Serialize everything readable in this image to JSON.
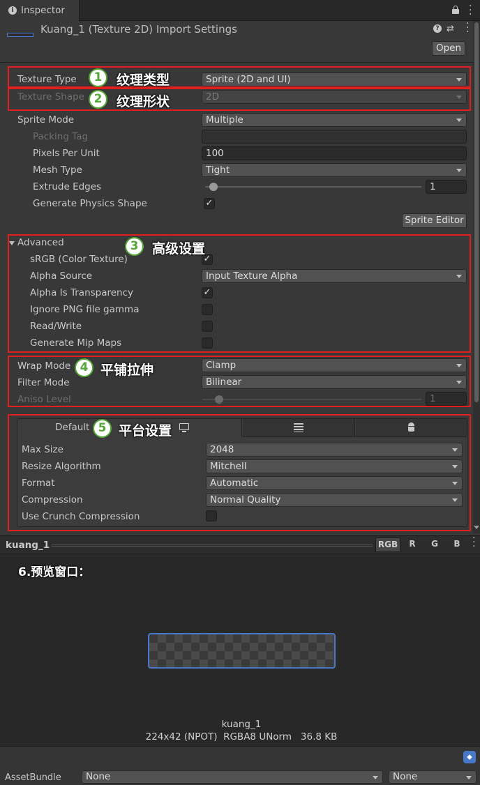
{
  "tab": {
    "title": "Inspector",
    "icon": "info-icon"
  },
  "header": {
    "title": "Kuang_1 (Texture 2D) Import Settings",
    "open_button": "Open"
  },
  "rows": {
    "texture_type": {
      "label": "Texture Type",
      "value": "Sprite (2D and UI)"
    },
    "texture_shape": {
      "label": "Texture Shape",
      "value": "2D"
    },
    "sprite_mode": {
      "label": "Sprite Mode",
      "value": "Multiple"
    },
    "packing_tag": {
      "label": "Packing Tag",
      "value": ""
    },
    "pixels_per_unit": {
      "label": "Pixels Per Unit",
      "value": "100"
    },
    "mesh_type": {
      "label": "Mesh Type",
      "value": "Tight"
    },
    "extrude_edges": {
      "label": "Extrude Edges",
      "value": "1"
    },
    "generate_physics_shape": {
      "label": "Generate Physics Shape",
      "checked": true
    },
    "sprite_editor_button": "Sprite Editor",
    "advanced": "Advanced",
    "srgb": {
      "label": "sRGB (Color Texture)",
      "checked": true
    },
    "alpha_source": {
      "label": "Alpha Source",
      "value": "Input Texture Alpha"
    },
    "alpha_is_transparency": {
      "label": "Alpha Is Transparency",
      "checked": true
    },
    "ignore_png_gamma": {
      "label": "Ignore PNG file gamma",
      "checked": false
    },
    "read_write": {
      "label": "Read/Write",
      "checked": false
    },
    "generate_mip_maps": {
      "label": "Generate Mip Maps",
      "checked": false
    },
    "wrap_mode": {
      "label": "Wrap Mode",
      "value": "Clamp"
    },
    "filter_mode": {
      "label": "Filter Mode",
      "value": "Bilinear"
    },
    "aniso_level": {
      "label": "Aniso Level",
      "value": "1"
    }
  },
  "platform": {
    "tabs": [
      "Default",
      "standalone-icon",
      "android-icon"
    ],
    "max_size": {
      "label": "Max Size",
      "value": "2048"
    },
    "resize_algorithm": {
      "label": "Resize Algorithm",
      "value": "Mitchell"
    },
    "format": {
      "label": "Format",
      "value": "Automatic"
    },
    "compression": {
      "label": "Compression",
      "value": "Normal Quality"
    },
    "use_crunch": {
      "label": "Use Crunch Compression",
      "checked": false
    }
  },
  "annotations": {
    "a1": {
      "num": "1",
      "text": "纹理类型"
    },
    "a2": {
      "num": "2",
      "text": "纹理形状"
    },
    "a3": {
      "num": "3",
      "text": "高级设置"
    },
    "a4": {
      "num": "4",
      "text": "平铺拉伸"
    },
    "a5": {
      "num": "5",
      "text": "平台设置"
    },
    "a6": "6.预览窗口："
  },
  "preview": {
    "name": "kuang_1",
    "channels": [
      "RGB",
      "R",
      "G",
      "B"
    ],
    "caption_name": "kuang_1",
    "caption_info": "224x42 (NPOT)  RGBA8 UNorm   36.8 KB"
  },
  "assetbundle": {
    "label": "AssetBundle",
    "name_value": "None",
    "variant_value": "None"
  },
  "colors": {
    "annotation_red": "#e11f1f",
    "badge_green": "#57a639",
    "selected_blue": "#4a78c8"
  }
}
